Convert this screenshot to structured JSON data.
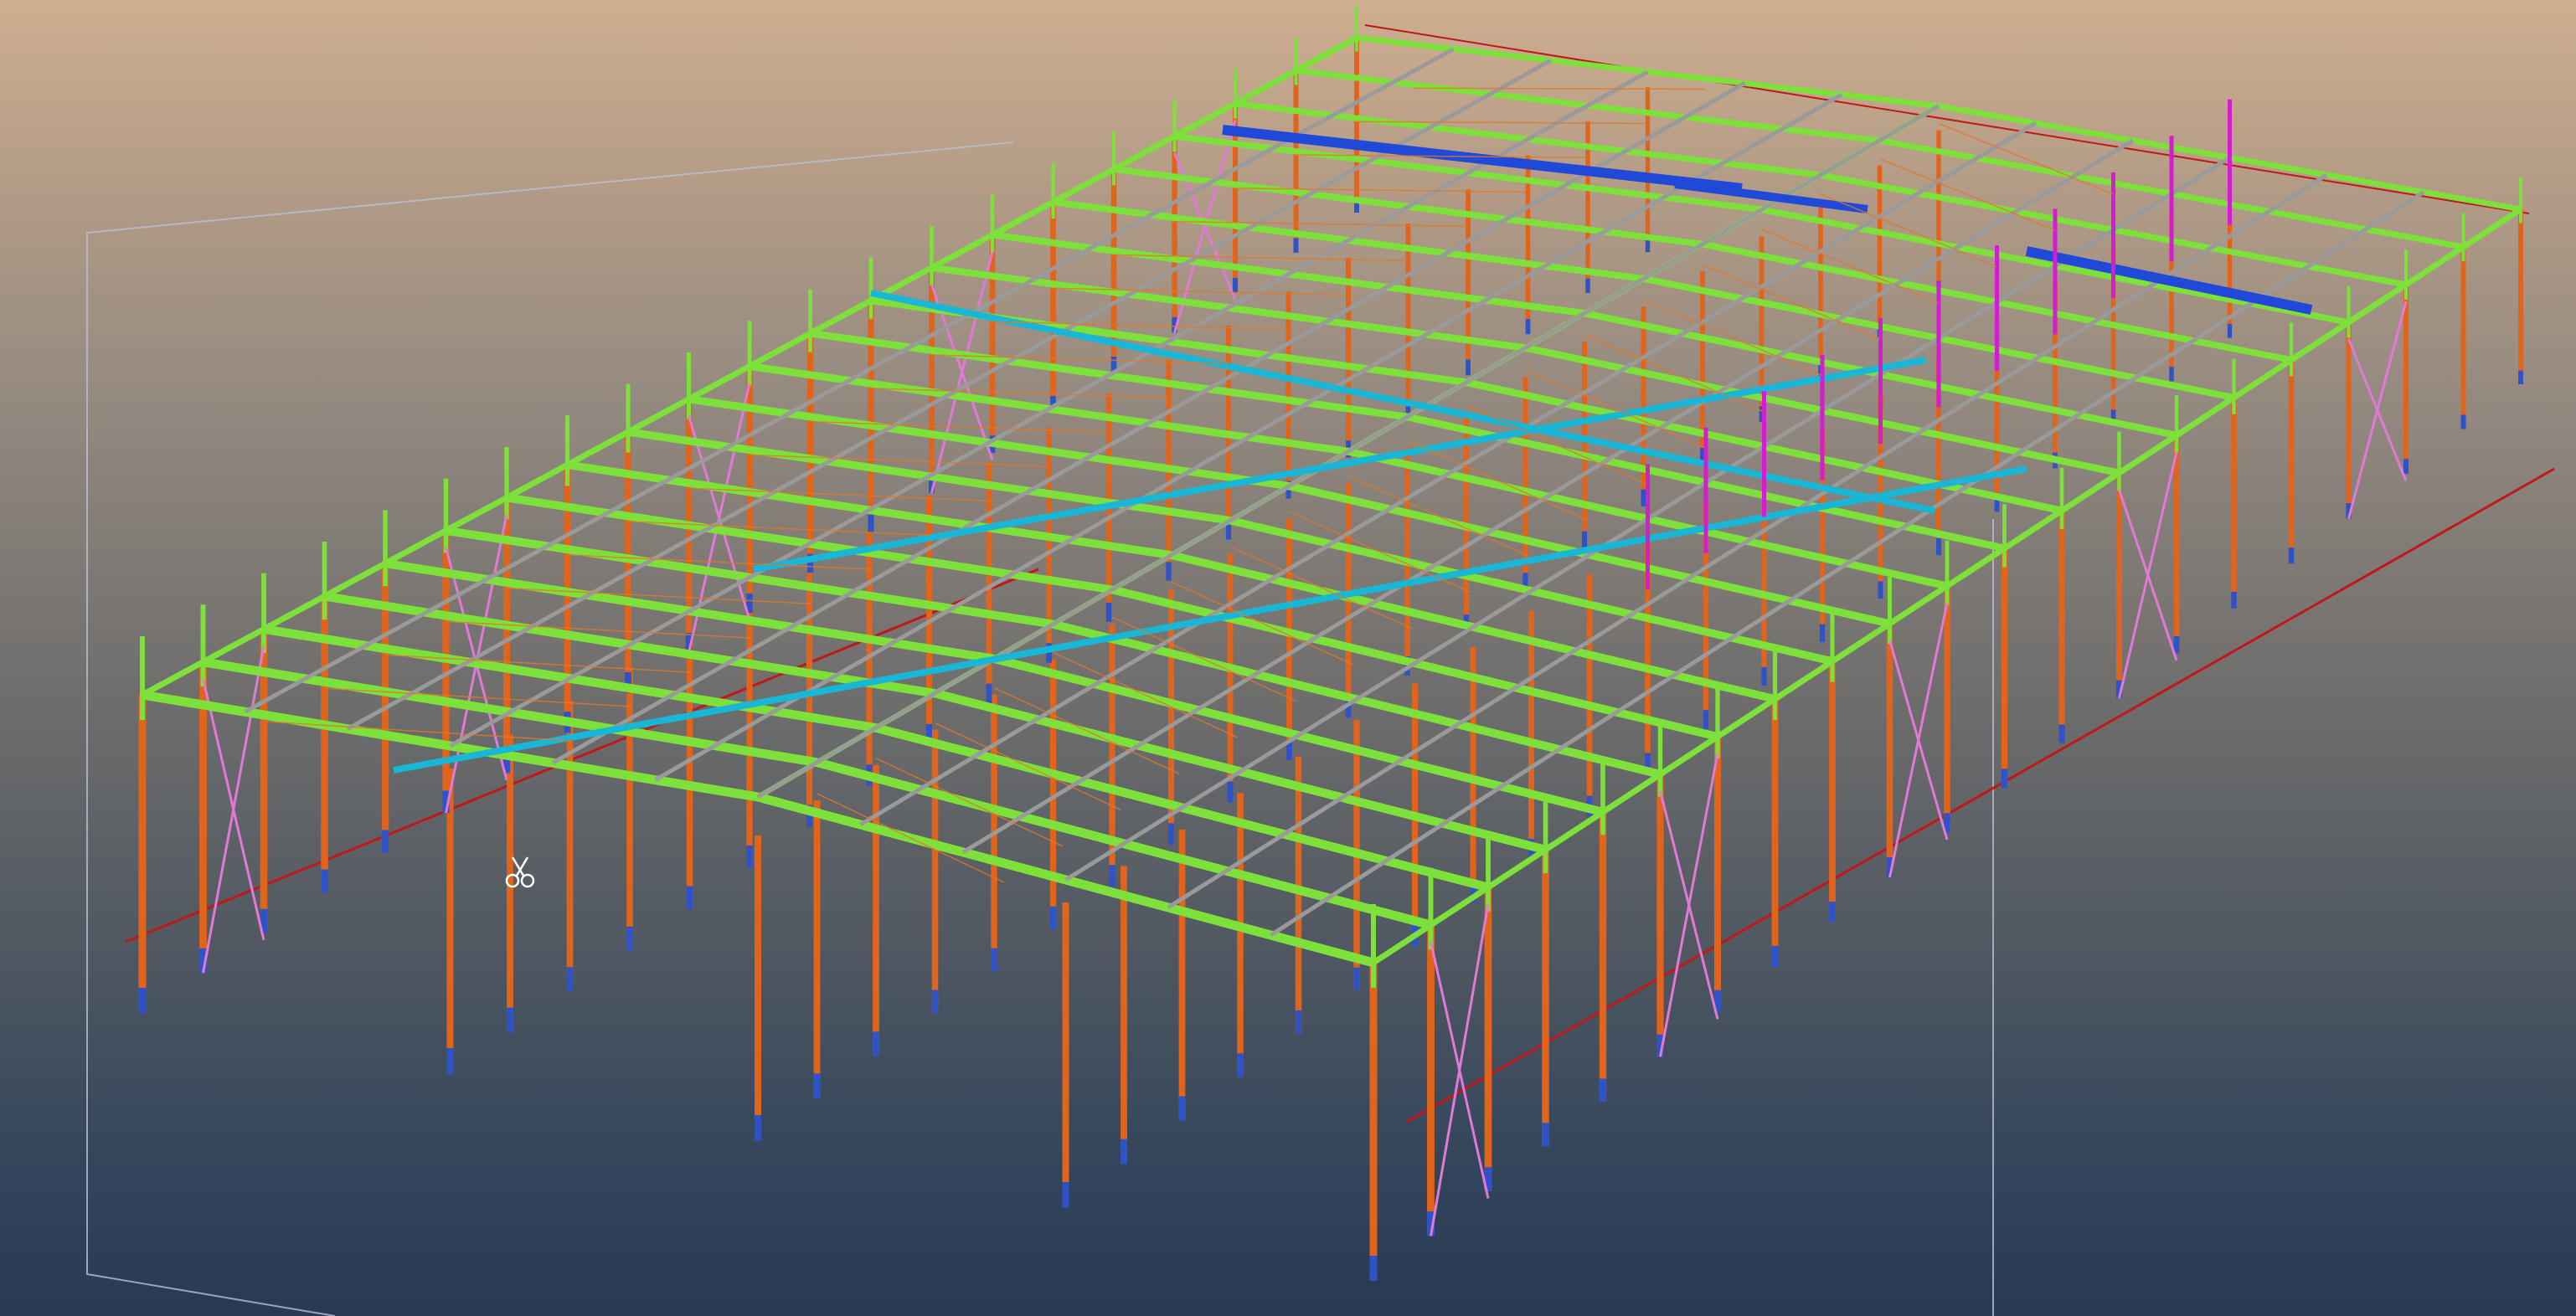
{
  "viewport": {
    "background_top": "#cfae90",
    "background_bottom": "#283a53"
  },
  "member_colors": {
    "column": "#e0641c",
    "column_base": "#2e52c8",
    "rafter": "#7ee03a",
    "purlin": "#9a9a9a",
    "beam_cyan": "#19b6d6",
    "beam_blue": "#1f49d6",
    "brace_pink": "#e07ad6",
    "brace_magenta": "#d21ecf",
    "tie_orange": "#e0782a",
    "rod_red": "#c01818",
    "work_plane": "#b9bfd6"
  },
  "icons": [
    "scissors-icon",
    "work-plane-frame",
    "structural-model"
  ]
}
